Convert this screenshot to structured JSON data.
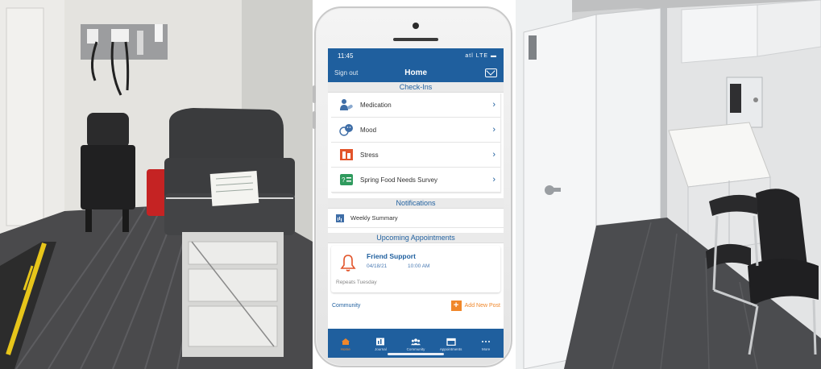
{
  "photos": {
    "left": {
      "alt": "exam-room-photo"
    },
    "right": {
      "alt": "clinic-hallway-photo"
    }
  },
  "phone": {
    "status": {
      "time": "11:45",
      "signal": "atl LTE ▬"
    },
    "header": {
      "sign_out": "Sign out",
      "title": "Home"
    },
    "checkins": {
      "heading": "Check-Ins",
      "items": [
        {
          "label": "Medication",
          "icon": "medication-icon"
        },
        {
          "label": "Mood",
          "icon": "mood-icon"
        },
        {
          "label": "Stress",
          "icon": "stress-icon"
        },
        {
          "label": "Spring Food Needs Survey",
          "icon": "survey-icon"
        }
      ]
    },
    "notifications": {
      "heading": "Notifications",
      "items": [
        {
          "label": "Weekly Summary",
          "icon": "chart-icon"
        }
      ]
    },
    "appointments": {
      "heading": "Upcoming Appointments",
      "item": {
        "name": "Friend Support",
        "date": "04/18/21",
        "time": "10:00 AM",
        "repeat": "Repeats Tuesday"
      }
    },
    "community": {
      "label": "Community",
      "add_label": "Add New Post"
    },
    "tabs": [
      {
        "label": "Home",
        "icon": "home-icon",
        "active": true
      },
      {
        "label": "Journal",
        "icon": "journal-icon",
        "active": false
      },
      {
        "label": "Community",
        "icon": "community-icon",
        "active": false
      },
      {
        "label": "Appointments",
        "icon": "calendar-icon",
        "active": false
      },
      {
        "label": "More",
        "icon": "more-icon",
        "active": false
      }
    ],
    "colors": {
      "primary": "#1f5f9e",
      "accent": "#f0872a",
      "section_bg": "#eaeaea"
    }
  }
}
